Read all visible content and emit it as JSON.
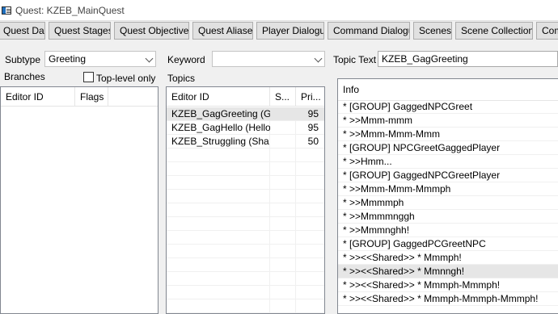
{
  "window": {
    "title": "Quest: KZEB_MainQuest",
    "icon": "window-app-icon"
  },
  "tabs": [
    "Quest Data",
    "Quest Stages",
    "Quest Objectives",
    "Quest Aliases",
    "Player Dialogue",
    "Command Dialogue",
    "Scenes",
    "Scene Collections",
    "Com"
  ],
  "form": {
    "subtype_label": "Subtype",
    "subtype_value": "Greeting",
    "keyword_label": "Keyword",
    "keyword_value": "",
    "topic_text_label": "Topic Text",
    "topic_text_value": "KZEB_GagGreeting",
    "branches_label": "Branches",
    "toplevel_label": "Top-level only",
    "toplevel_checked": false,
    "topics_label": "Topics"
  },
  "branches_list": {
    "columns": [
      "Editor ID",
      "Flags"
    ],
    "rows": []
  },
  "topics_list": {
    "columns": [
      "Editor ID",
      "S...",
      "Pri..."
    ],
    "rows": [
      {
        "editor_id": "KZEB_GagGreeting (Gr",
        "s": "",
        "priority": "95",
        "selected": true
      },
      {
        "editor_id": "KZEB_GagHello (Hello)",
        "s": "",
        "priority": "95",
        "selected": false
      },
      {
        "editor_id": "KZEB_Struggling (Sha",
        "s": "",
        "priority": "50",
        "selected": false
      }
    ]
  },
  "info_list": {
    "columns": [
      "Info"
    ],
    "rows": [
      "* [GROUP] GaggedNPCGreet",
      "* >>Mmm-mmm",
      "* >>Mmm-Mmm-Mmm",
      "* [GROUP] NPCGreetGaggedPlayer",
      "* >>Hmm...",
      "* [GROUP] GaggedNPCGreetPlayer",
      "* >>Mmm-Mmm-Mmmph",
      "* >>Mmmmph",
      "* >>Mmmmnggh",
      "* >>Mmmnghh!",
      "* [GROUP] GaggedPCGreetNPC",
      "* >><<Shared>> * Mmmph!",
      "* >><<Shared>> * Mmnngh!",
      "* >><<Shared>> * Mmmph-Mmmph!",
      "* >><<Shared>> * Mmmph-Mmmph-Mmmph!"
    ],
    "selected_index": 12
  }
}
